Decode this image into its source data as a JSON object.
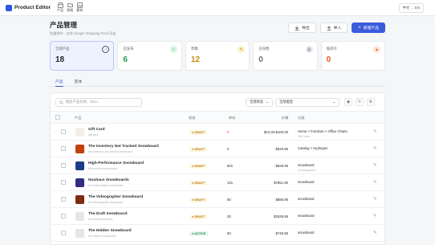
{
  "app": {
    "title": "Product Editor",
    "lang_button": "中文 → EN"
  },
  "topnav": [
    {
      "label": "产品",
      "icon": "store-icon"
    },
    {
      "label": "表格",
      "icon": "folder-icon"
    },
    {
      "label": "素材",
      "icon": "image-icon"
    }
  ],
  "header": {
    "title": "产品管理",
    "subtitle": "批量操作 · 支持 Google Shopping Feed 导出",
    "export_label": "导出",
    "import_label": "导入",
    "new_label": "新建产品"
  },
  "stats": [
    {
      "label": "全部产品",
      "value": "18",
      "icon_color": "#4b5563",
      "bg": "#eef2ff",
      "val_color": "#1f2329",
      "icon": "help-circle-icon"
    },
    {
      "label": "已发布",
      "value": "6",
      "icon_color": "#16a34a",
      "bg": "#e7f7ee",
      "val_color": "#16a34a",
      "icon": "check-circle-icon"
    },
    {
      "label": "草稿",
      "value": "12",
      "icon_color": "#ca8a04",
      "bg": "#fdf6dd",
      "val_color": "#ca8a04",
      "icon": "pencil-icon"
    },
    {
      "label": "已归档",
      "value": "0",
      "icon_color": "#6b7280",
      "bg": "#eef0f3",
      "val_color": "#6b7280",
      "icon": "archive-icon"
    },
    {
      "label": "低库存",
      "value": "0",
      "icon_color": "#ea580c",
      "bg": "#fdeee3",
      "val_color": "#ea580c",
      "icon": "warning-icon"
    }
  ],
  "tabs": [
    "产品",
    "变体"
  ],
  "filters": {
    "search_placeholder": "搜索产品名称、SKU...",
    "status_value": "全部状态",
    "type_value": "全部类型"
  },
  "table": {
    "headers": {
      "product": "产品",
      "status": "状态",
      "stock": "库存",
      "price": "价格",
      "collection": "分类"
    },
    "rows": [
      {
        "name": "Gift Card",
        "sub": "gift-card",
        "status": "DRAFT",
        "stock": "0",
        "stock_color": "#e03131",
        "price": "$10.00-$100.00",
        "collection": "Home > Furniture > Office Chairs",
        "collection_sub": "Gift Cards",
        "thumb": "#f4efe6",
        "expand": "›"
      },
      {
        "name": "The Inventory Not Tracked Snowboard",
        "sub": "the-inventory-not-tracked-snowboard",
        "status": "DRAFT",
        "stock": "0",
        "stock_color": "#1f2329",
        "price": "$949.95",
        "collection": "Catalog > Hydrogen",
        "collection_sub": "",
        "thumb": "#c2410c",
        "expand": ""
      },
      {
        "name": "High-Performance Snowboard",
        "sub": "the-archived-snowboard",
        "status": "DRAFT",
        "stock": "501",
        "stock_color": "#1f2329",
        "price": "$629.95",
        "collection": "snowboard",
        "collection_sub": "Uncategorized",
        "thumb": "#1e3a8a",
        "expand": ""
      },
      {
        "name": "Nouhaus Snowboards",
        "sub": "the-multi-location-snowboard",
        "status": "DRAFT",
        "stock": "101",
        "stock_color": "#1f2329",
        "price": "$7851.90",
        "collection": "snowboard",
        "collection_sub": "",
        "thumb": "#312e81",
        "expand": ""
      },
      {
        "name": "The Videographer Snowboard",
        "sub": "the-videographer-snowboard",
        "status": "DRAFT",
        "stock": "50",
        "stock_color": "#1f2329",
        "price": "$885.95",
        "collection": "snowboard",
        "collection_sub": "",
        "thumb": "#7c2d12",
        "expand": ""
      },
      {
        "name": "The Draft Snowboard",
        "sub": "the-draft-snowboard",
        "status": "DRAFT",
        "stock": "20",
        "stock_color": "#1f2329",
        "price": "$2629.95",
        "collection": "snowboard",
        "collection_sub": "",
        "thumb": "#e5e7eb",
        "expand": ""
      },
      {
        "name": "The Hidden Snowboard",
        "sub": "the-hidden-snowboard",
        "status": "ACTIVE",
        "stock": "50",
        "stock_color": "#1f2329",
        "price": "$749.95",
        "collection": "snowboard",
        "collection_sub": "",
        "thumb": "#e5e7eb",
        "expand": ""
      }
    ]
  }
}
